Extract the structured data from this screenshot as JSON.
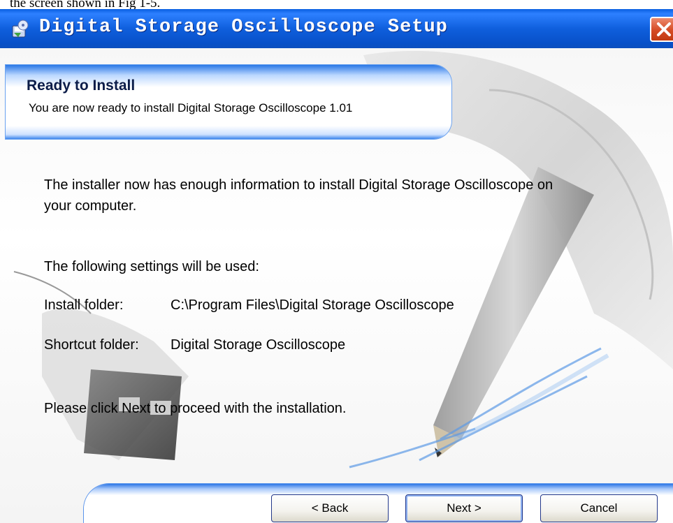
{
  "document": {
    "caption": "the screen shown in Fig 1-5."
  },
  "window": {
    "title": "Digital Storage Oscilloscope Setup",
    "close_icon": "close-icon",
    "app_icon": "setup-disk-icon"
  },
  "banner": {
    "title": "Ready to Install",
    "subtitle": "You are now ready to install Digital Storage Oscilloscope 1.01"
  },
  "body": {
    "intro_line1": "The installer now has enough information to install Digital Storage Oscilloscope on",
    "intro_line2": "your computer.",
    "settings_heading": "The following settings will be used:",
    "settings": [
      {
        "label": "Install folder:",
        "value": "C:\\Program Files\\Digital Storage Oscilloscope"
      },
      {
        "label": "Shortcut folder:",
        "value": "Digital Storage Oscilloscope"
      }
    ],
    "proceed_text": "Please click Next to proceed with the installation."
  },
  "buttons": {
    "back_label": "< Back",
    "next_label": "Next >",
    "cancel_label": "Cancel"
  },
  "colors": {
    "titlebar": "#0f5fdd",
    "close_button": "#d54a23",
    "accent_blue": "#2a78e6"
  }
}
